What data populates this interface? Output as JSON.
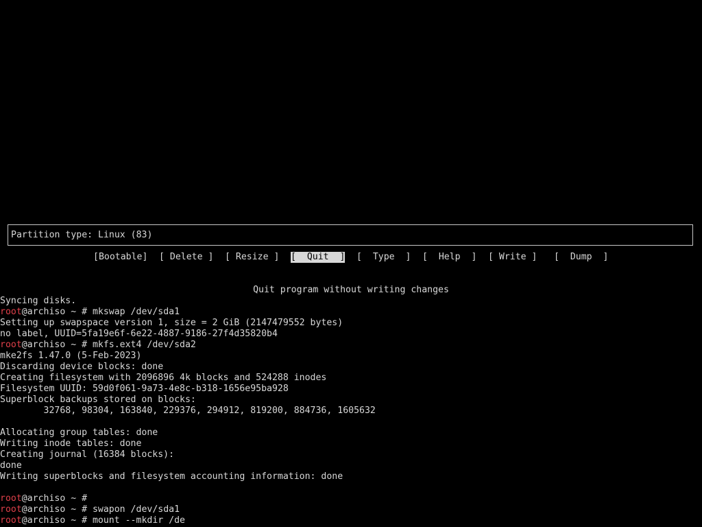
{
  "partition_info": "Partition type: Linux (83)",
  "menu": [
    {
      "label": "[Bootable]",
      "name": "bootable-button",
      "selected": false
    },
    {
      "label": "[ Delete ]",
      "name": "delete-button",
      "selected": false
    },
    {
      "label": "[ Resize ]",
      "name": "resize-button",
      "selected": false
    },
    {
      "label": "[  Quit  ]",
      "name": "quit-button",
      "selected": true
    },
    {
      "label": "[  Type  ]",
      "name": "type-button",
      "selected": false
    },
    {
      "label": "[  Help  ]",
      "name": "help-button",
      "selected": false
    },
    {
      "label": "[ Write ]",
      "name": "write-button",
      "selected": false
    },
    {
      "label": "[  Dump  ]",
      "name": "dump-button",
      "selected": false
    }
  ],
  "help_text": "Quit program without writing changes",
  "prompt": {
    "user": "root",
    "host_suffix": "@archiso ~ # "
  },
  "console": [
    {
      "type": "text",
      "text": "Syncing disks."
    },
    {
      "type": "prompt",
      "text": "mkswap /dev/sda1"
    },
    {
      "type": "text",
      "text": "Setting up swapspace version 1, size = 2 GiB (2147479552 bytes)"
    },
    {
      "type": "text",
      "text": "no label, UUID=5fa19e6f-6e22-4887-9186-27f4d35820b4"
    },
    {
      "type": "prompt",
      "text": "mkfs.ext4 /dev/sda2"
    },
    {
      "type": "text",
      "text": "mke2fs 1.47.0 (5-Feb-2023)"
    },
    {
      "type": "text",
      "text": "Discarding device blocks: done"
    },
    {
      "type": "text",
      "text": "Creating filesystem with 2096896 4k blocks and 524288 inodes"
    },
    {
      "type": "text",
      "text": "Filesystem UUID: 59d0f061-9a73-4e8c-b318-1656e95ba928"
    },
    {
      "type": "text",
      "text": "Superblock backups stored on blocks:"
    },
    {
      "type": "text",
      "text": "        32768, 98304, 163840, 229376, 294912, 819200, 884736, 1605632"
    },
    {
      "type": "text",
      "text": ""
    },
    {
      "type": "text",
      "text": "Allocating group tables: done"
    },
    {
      "type": "text",
      "text": "Writing inode tables: done"
    },
    {
      "type": "text",
      "text": "Creating journal (16384 blocks):"
    },
    {
      "type": "text",
      "text": "done"
    },
    {
      "type": "text",
      "text": "Writing superblocks and filesystem accounting information: done"
    },
    {
      "type": "text",
      "text": ""
    },
    {
      "type": "prompt",
      "text": ""
    },
    {
      "type": "prompt",
      "text": "swapon /dev/sda1"
    },
    {
      "type": "prompt",
      "text": "mount --mkdir /de"
    }
  ]
}
